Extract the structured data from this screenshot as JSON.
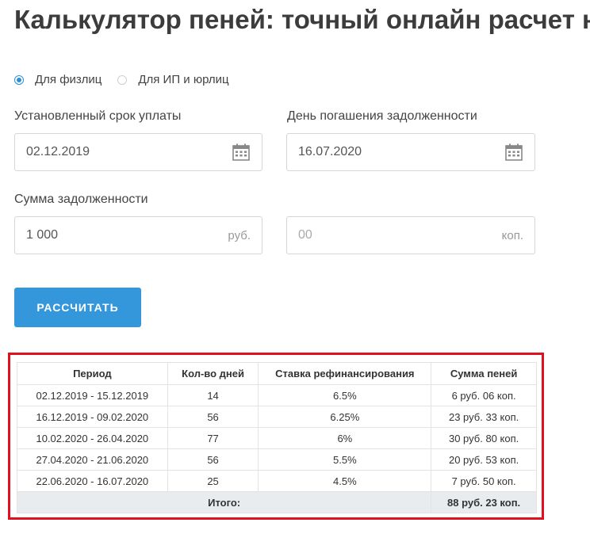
{
  "page": {
    "title": "Калькулятор пеней: точный онлайн расчет налоговой задолженности"
  },
  "radios": [
    {
      "label": "Для физлиц",
      "checked": true
    },
    {
      "label": "Для ИП и юрлиц",
      "checked": false
    }
  ],
  "fields": {
    "due_date_label": "Установленный срок уплаты",
    "due_date_value": "02.12.2019",
    "payoff_date_label": "День погашения задолженности",
    "payoff_date_value": "16.07.2020",
    "amount_label": "Сумма задолженности",
    "rub_value": "1 000",
    "rub_unit": "руб.",
    "kop_value": "00",
    "kop_unit": "коп."
  },
  "button": {
    "label": "РАССЧИТАТЬ"
  },
  "table": {
    "headers": [
      "Период",
      "Кол-во дней",
      "Ставка рефинансирования",
      "Сумма пеней"
    ],
    "rows": [
      [
        "02.12.2019 - 15.12.2019",
        "14",
        "6.5%",
        "6 руб. 06 коп."
      ],
      [
        "16.12.2019 - 09.02.2020",
        "56",
        "6.25%",
        "23 руб. 33 коп."
      ],
      [
        "10.02.2020 - 26.04.2020",
        "77",
        "6%",
        "30 руб. 80 коп."
      ],
      [
        "27.04.2020 - 21.06.2020",
        "56",
        "5.5%",
        "20 руб. 53 коп."
      ],
      [
        "22.06.2020 - 16.07.2020",
        "25",
        "4.5%",
        "7 руб. 50 коп."
      ]
    ],
    "total_label": "Итого:",
    "total_value": "88 руб. 23 коп."
  },
  "colors": {
    "accent": "#3597db",
    "highlight_border": "#e0101f"
  },
  "icons": {
    "date_picker": "calendar-icon"
  }
}
